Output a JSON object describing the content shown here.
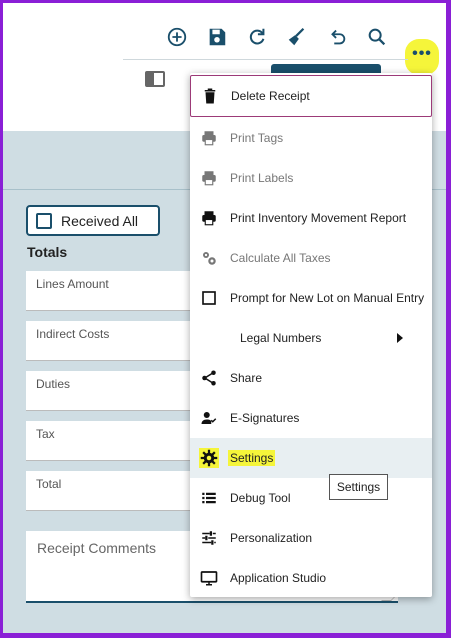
{
  "toolbar": {
    "icons": [
      "add-icon",
      "save-icon",
      "refresh-icon",
      "clear-icon",
      "undo-icon",
      "search-icon",
      "more-icon"
    ],
    "more_label": "•••",
    "accent": "#1a4f6b",
    "highlight": "#f5f53a"
  },
  "form": {
    "received_all_label": "Received All",
    "totals_heading": "Totals",
    "fields": [
      {
        "label": "Lines Amount"
      },
      {
        "label": "Indirect Costs"
      },
      {
        "label": "Duties"
      },
      {
        "label": "Tax"
      },
      {
        "label": "Total"
      }
    ],
    "comments_placeholder": "Receipt Comments"
  },
  "menu": {
    "items": [
      {
        "label": "Delete Receipt",
        "icon": "trash-icon",
        "disabled": false
      },
      {
        "label": "Print Tags",
        "icon": "printer-icon",
        "disabled": true
      },
      {
        "label": "Print Labels",
        "icon": "printer-icon",
        "disabled": true
      },
      {
        "label": "Print Inventory Movement Report",
        "icon": "printer-icon",
        "disabled": false
      },
      {
        "label": "Calculate All Taxes",
        "icon": "gears-icon",
        "disabled": true
      },
      {
        "label": "Prompt for New Lot on Manual Entry",
        "icon": "checkbox-icon",
        "disabled": false
      },
      {
        "label": "Legal Numbers",
        "icon": "submenu-arrow-icon",
        "disabled": false
      },
      {
        "label": "Share",
        "icon": "share-icon",
        "disabled": false
      },
      {
        "label": "E-Signatures",
        "icon": "signature-icon",
        "disabled": false
      },
      {
        "label": "Settings",
        "icon": "gear-icon",
        "disabled": false
      },
      {
        "label": "Debug Tool",
        "icon": "list-icon",
        "disabled": false
      },
      {
        "label": "Personalization",
        "icon": "sliders-icon",
        "disabled": false
      },
      {
        "label": "Application Studio",
        "icon": "monitor-icon",
        "disabled": false
      }
    ]
  },
  "tooltip": "Settings"
}
